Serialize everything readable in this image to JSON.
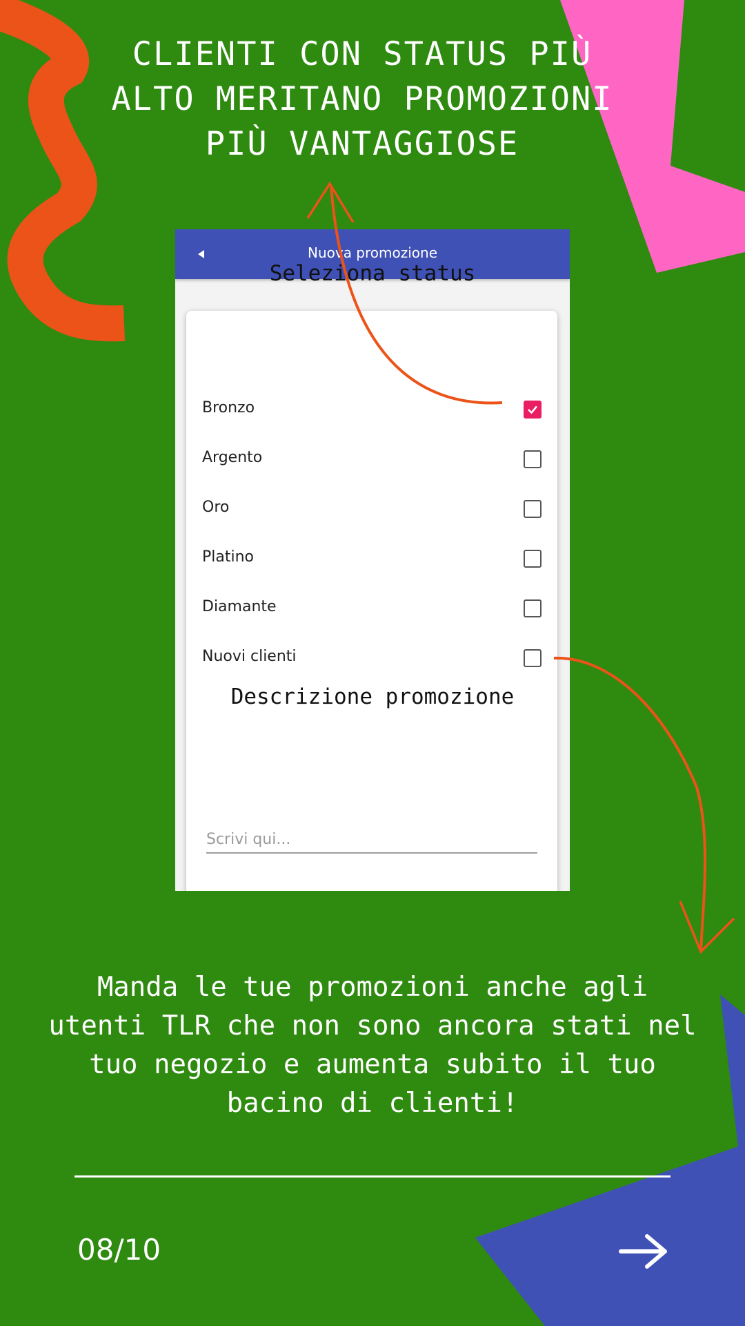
{
  "headline": "CLIENTI CON STATUS PIÙ ALTO MERITANO PROMOZIONI PIÙ VANTAGGIOSE",
  "app": {
    "title": "Nuova promozione",
    "back_icon": "back-arrow-icon",
    "status_title": "Seleziona status",
    "status_options": [
      {
        "label": "Bronzo",
        "checked": true
      },
      {
        "label": "Argento",
        "checked": false
      },
      {
        "label": "Oro",
        "checked": false
      },
      {
        "label": "Platino",
        "checked": false
      },
      {
        "label": "Diamante",
        "checked": false
      },
      {
        "label": "Nuovi clienti",
        "checked": false
      }
    ],
    "description_title": "Descrizione promozione",
    "description_placeholder": "Scrivi qui...",
    "description_value": ""
  },
  "body_text": "Manda le tue promozioni anche agli utenti TLR che non sono ancora stati nel tuo negozio e aumenta subito il tuo bacino di clienti!",
  "page_counter": "08/10",
  "next_icon": "arrow-right-icon",
  "colors": {
    "background": "#2f8a10",
    "orange": "#eb5319",
    "pink": "#ff66c4",
    "blue": "#3f51b5",
    "checkbox_checked": "#e91e63",
    "text": "#ffffff"
  }
}
